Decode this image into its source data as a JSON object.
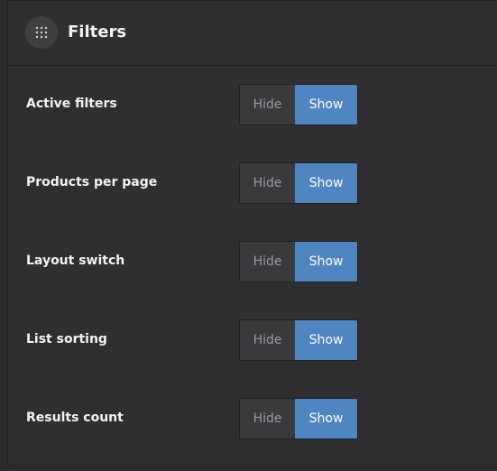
{
  "panel": {
    "title": "Filters",
    "handle_icon": "drag-handle-icon"
  },
  "options": [
    {
      "label": "Active filters",
      "hide_label": "Hide",
      "show_label": "Show",
      "selected": "Show"
    },
    {
      "label": "Products per page",
      "hide_label": "Hide",
      "show_label": "Show",
      "selected": "Show"
    },
    {
      "label": "Layout switch",
      "hide_label": "Hide",
      "show_label": "Show",
      "selected": "Show"
    },
    {
      "label": "List sorting",
      "hide_label": "Hide",
      "show_label": "Show",
      "selected": "Show"
    },
    {
      "label": "Results count",
      "hide_label": "Hide",
      "show_label": "Show",
      "selected": "Show"
    }
  ],
  "colors": {
    "panel_bg": "#2f2f31",
    "accent": "#4f86c1",
    "inactive": "#3a3a3d"
  }
}
